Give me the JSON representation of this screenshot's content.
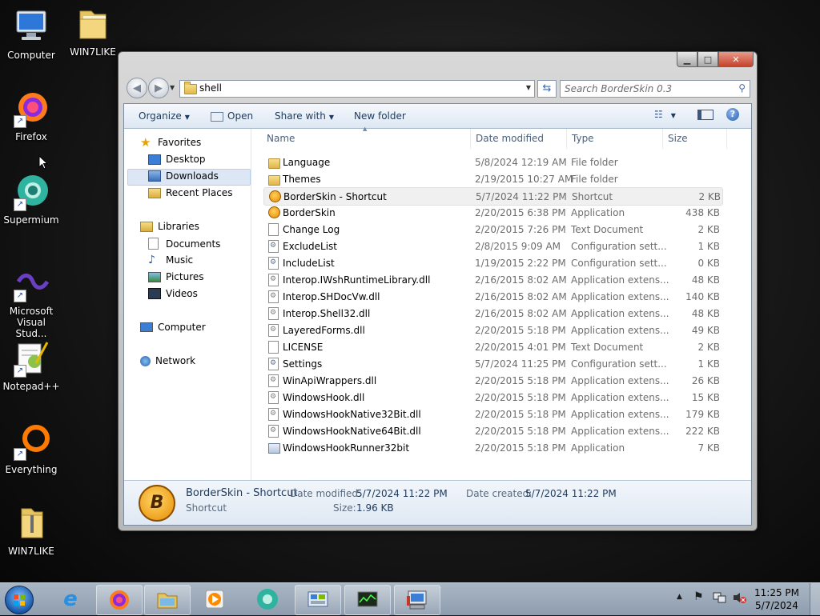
{
  "desktop": {
    "icons": [
      {
        "label": "Computer",
        "icon": "computer-icon"
      },
      {
        "label": "WIN7LIKE",
        "icon": "folder-icon"
      },
      {
        "label": "Firefox",
        "icon": "firefox-icon"
      },
      {
        "label": "Supermium",
        "icon": "supermium-icon"
      },
      {
        "label": "Microsoft Visual Stud...",
        "icon": "visual-studio-icon"
      },
      {
        "label": "Notepad++",
        "icon": "notepadpp-icon"
      },
      {
        "label": "Everything",
        "icon": "everything-icon"
      },
      {
        "label": "WIN7LIKE",
        "icon": "zip-folder-icon"
      }
    ]
  },
  "window": {
    "address_text": "shell",
    "search_placeholder": "Search BorderSkin 0.3",
    "toolbar": {
      "organize": "Organize",
      "open": "Open",
      "share_with": "Share with",
      "new_folder": "New folder"
    },
    "nav": {
      "favorites": "Favorites",
      "desktop": "Desktop",
      "downloads": "Downloads",
      "recent_places": "Recent Places",
      "libraries": "Libraries",
      "documents": "Documents",
      "music": "Music",
      "pictures": "Pictures",
      "videos": "Videos",
      "computer": "Computer",
      "network": "Network"
    },
    "columns": {
      "name": "Name",
      "date": "Date modified",
      "type": "Type",
      "size": "Size"
    },
    "files": [
      {
        "name": "Language",
        "date": "5/8/2024 12:19 AM",
        "type": "File folder",
        "size": "",
        "icon": "folder"
      },
      {
        "name": "Themes",
        "date": "2/19/2015 10:27 AM",
        "type": "File folder",
        "size": "",
        "icon": "folder"
      },
      {
        "name": "BorderSkin - Shortcut",
        "date": "5/7/2024 11:22 PM",
        "type": "Shortcut",
        "size": "2 KB",
        "icon": "bs"
      },
      {
        "name": "BorderSkin",
        "date": "2/20/2015 6:38 PM",
        "type": "Application",
        "size": "438 KB",
        "icon": "bs"
      },
      {
        "name": "Change Log",
        "date": "2/20/2015 7:26 PM",
        "type": "Text Document",
        "size": "2 KB",
        "icon": "doc"
      },
      {
        "name": "ExcludeList",
        "date": "2/8/2015 9:09 AM",
        "type": "Configuration sett...",
        "size": "1 KB",
        "icon": "cfg"
      },
      {
        "name": "IncludeList",
        "date": "1/19/2015 2:22 PM",
        "type": "Configuration sett...",
        "size": "0 KB",
        "icon": "cfg"
      },
      {
        "name": "Interop.IWshRuntimeLibrary.dll",
        "date": "2/16/2015 8:02 AM",
        "type": "Application extens...",
        "size": "48 KB",
        "icon": "dll"
      },
      {
        "name": "Interop.SHDocVw.dll",
        "date": "2/16/2015 8:02 AM",
        "type": "Application extens...",
        "size": "140 KB",
        "icon": "dll"
      },
      {
        "name": "Interop.Shell32.dll",
        "date": "2/16/2015 8:02 AM",
        "type": "Application extens...",
        "size": "48 KB",
        "icon": "dll"
      },
      {
        "name": "LayeredForms.dll",
        "date": "2/20/2015 5:18 PM",
        "type": "Application extens...",
        "size": "49 KB",
        "icon": "dll"
      },
      {
        "name": "LICENSE",
        "date": "2/20/2015 4:01 PM",
        "type": "Text Document",
        "size": "2 KB",
        "icon": "doc"
      },
      {
        "name": "Settings",
        "date": "5/7/2024 11:25 PM",
        "type": "Configuration sett...",
        "size": "1 KB",
        "icon": "cfg"
      },
      {
        "name": "WinApiWrappers.dll",
        "date": "2/20/2015 5:18 PM",
        "type": "Application extens...",
        "size": "26 KB",
        "icon": "dll"
      },
      {
        "name": "WindowsHook.dll",
        "date": "2/20/2015 5:18 PM",
        "type": "Application extens...",
        "size": "15 KB",
        "icon": "dll"
      },
      {
        "name": "WindowsHookNative32Bit.dll",
        "date": "2/20/2015 5:18 PM",
        "type": "Application extens...",
        "size": "179 KB",
        "icon": "dll"
      },
      {
        "name": "WindowsHookNative64Bit.dll",
        "date": "2/20/2015 5:18 PM",
        "type": "Application extens...",
        "size": "222 KB",
        "icon": "dll"
      },
      {
        "name": "WindowsHookRunner32bit",
        "date": "2/20/2015 5:18 PM",
        "type": "Application",
        "size": "7 KB",
        "icon": "app"
      }
    ],
    "details": {
      "name": "BorderSkin - Shortcut",
      "kind": "Shortcut",
      "modified_label": "Date modified:",
      "modified_value": "5/7/2024 11:22 PM",
      "created_label": "Date created:",
      "created_value": "5/7/2024 11:22 PM",
      "size_label": "Size:",
      "size_value": "1.96 KB"
    }
  },
  "taskbar": {
    "time": "11:25 PM",
    "date": "5/7/2024",
    "pinned": [
      "internet-explorer-icon",
      "firefox-icon",
      "explorer-icon",
      "media-player-icon",
      "supermium-icon",
      "control-panel-icon",
      "task-manager-icon",
      "device-manager-icon"
    ]
  },
  "colors": {
    "accent": "#1e395b",
    "selection": "#dce6f4",
    "taskbar": "#9aa8b8"
  }
}
